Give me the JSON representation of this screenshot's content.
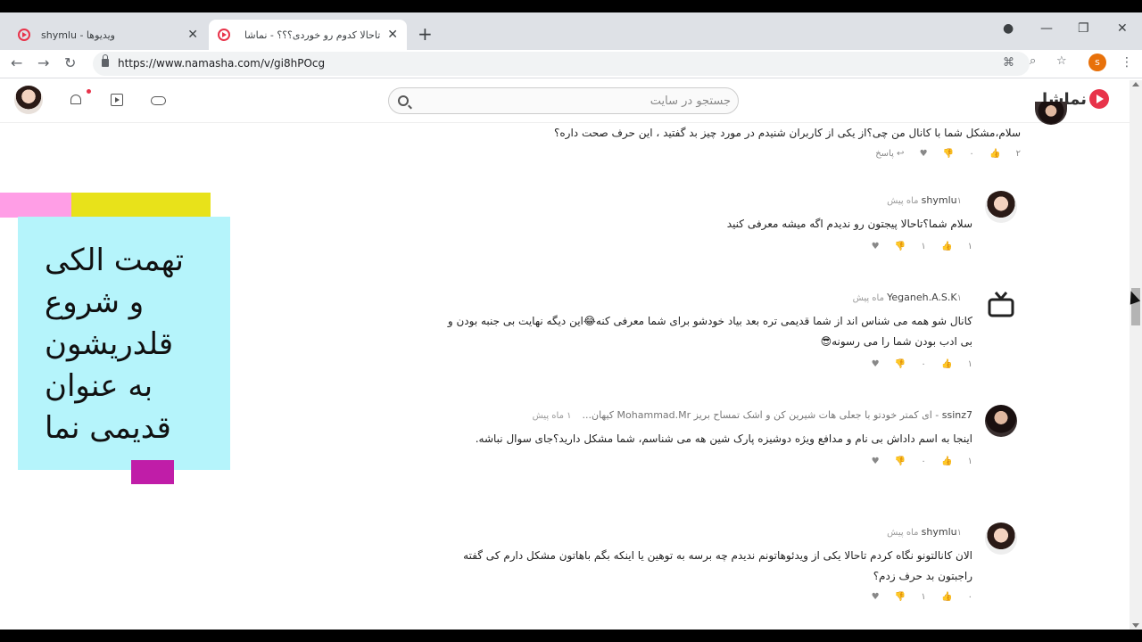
{
  "browser": {
    "tabs": [
      {
        "title": "shymlu - ویدیوها",
        "active": false
      },
      {
        "title": "تاحالا کدوم رو خوردی؟؟؟ - نماشا",
        "active": true
      }
    ],
    "url": "https://www.namasha.com/v/gi8hPOcg",
    "profile_initial": "s"
  },
  "site": {
    "logo_text": "نماشا",
    "search_placeholder": "جستجو در سایت"
  },
  "overlay": {
    "lines": [
      "تهمت الکی",
      "و شروع",
      "قلدریشون",
      "به عنوان",
      "قدیمی نما"
    ],
    "colors": {
      "card": "#b5f4fb",
      "pink": "#ff9ee6",
      "yellow": "#e8e21a",
      "magenta": "#c01da8"
    }
  },
  "comments": [
    {
      "author": "",
      "time": "",
      "text": "سلام،مشکل شما با کانال من چی؟از یکی از کاربران شنیدم در مورد چیز بد گفتید ، این حرف صحت داره؟",
      "likes": "۲",
      "dislikes": "۰",
      "reply": "پاسخ"
    },
    {
      "author": "shymlu",
      "time": "۱ ماه پیش",
      "text": "سلام شما؟تاحالا پیجتون رو ندیدم اگه میشه معرفی کنید",
      "likes": "۱",
      "dislikes": "۱"
    },
    {
      "author": "Yeganeh.A.S.K",
      "time": "۱ ماه پیش",
      "text": "کانال شو همه می شناس اند از شما قدیمی تره بعد بیاد خودشو برای شما معرفی کنه😂این دیگه نهایت بی جنبه بودن و بی ادب بودن شما را می رسونه😎",
      "likes": "۱",
      "dislikes": "۰"
    },
    {
      "author": "ssinz7",
      "reply_to": "- ای کمتر خودتو با جعلی هات شیرین کن و اشک تمساح بریز Mohammad.Mr کیهان...",
      "time": "۱ ماه پیش",
      "text": "اینجا به اسم داداش بی نام و مدافع ویژه دوشیزه پارک شین هه می شناسم، شما مشکل دارید؟جای سوال نباشه.",
      "likes": "۱",
      "dislikes": "۰"
    },
    {
      "author": "shymlu",
      "time": "۱ ماه پیش",
      "text": "الان کانالتونو نگاه کردم تاحالا یکی از ویدئوهاتونم ندیدم چه برسه به توهین یا اینکه بگم باهاتون مشکل دارم کی گفته راجبتون بد حرف زدم؟",
      "likes": "۰",
      "dislikes": "۱"
    }
  ]
}
